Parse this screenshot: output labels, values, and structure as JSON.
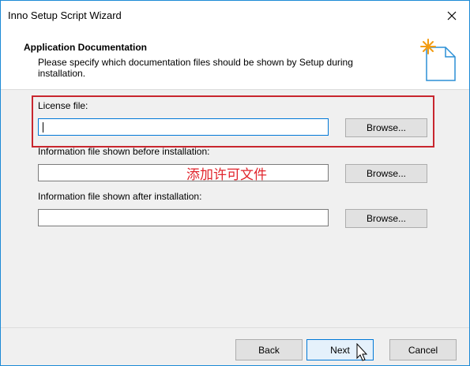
{
  "window": {
    "title": "Inno Setup Script Wizard"
  },
  "header": {
    "title": "Application Documentation",
    "description": "Please specify which documentation files should be shown by Setup during installation."
  },
  "fields": [
    {
      "label": "License file:",
      "value": "",
      "browse_label": "Browse..."
    },
    {
      "label": "Information file shown before installation:",
      "value": "",
      "browse_label": "Browse..."
    },
    {
      "label": "Information file shown after installation:",
      "value": "",
      "browse_label": "Browse..."
    }
  ],
  "annotation": {
    "text": "添加许可文件",
    "color": "#e1242c"
  },
  "footer": {
    "back_label": "Back",
    "next_label": "Next",
    "cancel_label": "Cancel"
  },
  "icons": {
    "close": "close-icon",
    "wizard": "wizard-document-icon",
    "cursor": "mouse-pointer-icon"
  },
  "colors": {
    "accent": "#0078d7",
    "highlight": "#c8262e"
  }
}
